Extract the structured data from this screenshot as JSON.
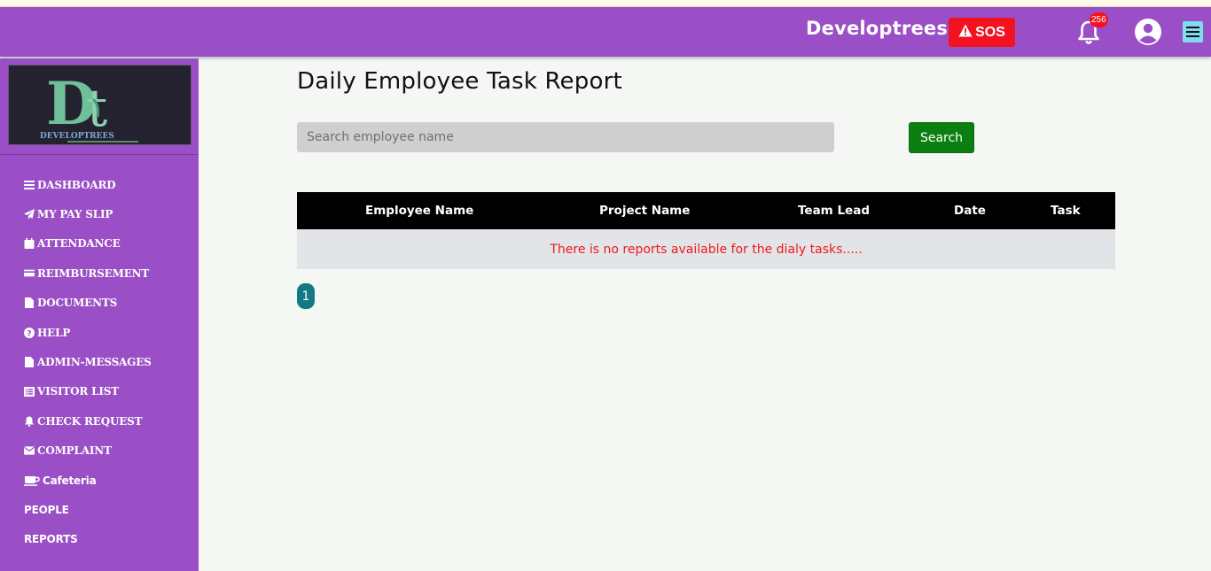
{
  "header": {
    "brand": "Developtrees",
    "sos_label": "SOS",
    "notification_count": "256"
  },
  "sidebar": {
    "logo_text": "DEVELOPTREES",
    "items": [
      {
        "label": "DASHBOARD",
        "icon": "bars-icon"
      },
      {
        "label": "MY PAY SLIP",
        "icon": "paper-plane-icon"
      },
      {
        "label": "ATTENDANCE",
        "icon": "calendar-icon"
      },
      {
        "label": "REIMBURSEMENT",
        "icon": "credit-card-icon"
      },
      {
        "label": "DOCUMENTS",
        "icon": "document-icon"
      },
      {
        "label": "HELP",
        "icon": "question-circle-icon"
      },
      {
        "label": "ADMIN-MESSAGES",
        "icon": "document-icon"
      },
      {
        "label": "VISITOR LIST",
        "icon": "list-icon"
      },
      {
        "label": "CHECK REQUEST",
        "icon": "bell-icon"
      },
      {
        "label": "COMPLAINT",
        "icon": "envelope-icon"
      },
      {
        "label": "Cafeteria",
        "icon": "coffee-cup-icon"
      },
      {
        "label": "PEOPLE",
        "icon": ""
      },
      {
        "label": "REPORTS",
        "icon": ""
      }
    ]
  },
  "main": {
    "title": "Daily Employee Task Report",
    "search_placeholder": "Search employee name",
    "search_button": "Search",
    "table": {
      "columns": [
        "Employee Name",
        "Project Name",
        "Team Lead",
        "Date",
        "Task"
      ],
      "empty_message": "There is no reports available for the dialy tasks....."
    },
    "pagination": {
      "current_page": "1"
    }
  },
  "colors": {
    "header_bg": "#9b4fc6",
    "sos_bg": "#f3121f",
    "search_btn": "#0b7f10",
    "table_head": "#000000",
    "empty_text": "#ee1b1b",
    "page_btn": "#117a84"
  }
}
